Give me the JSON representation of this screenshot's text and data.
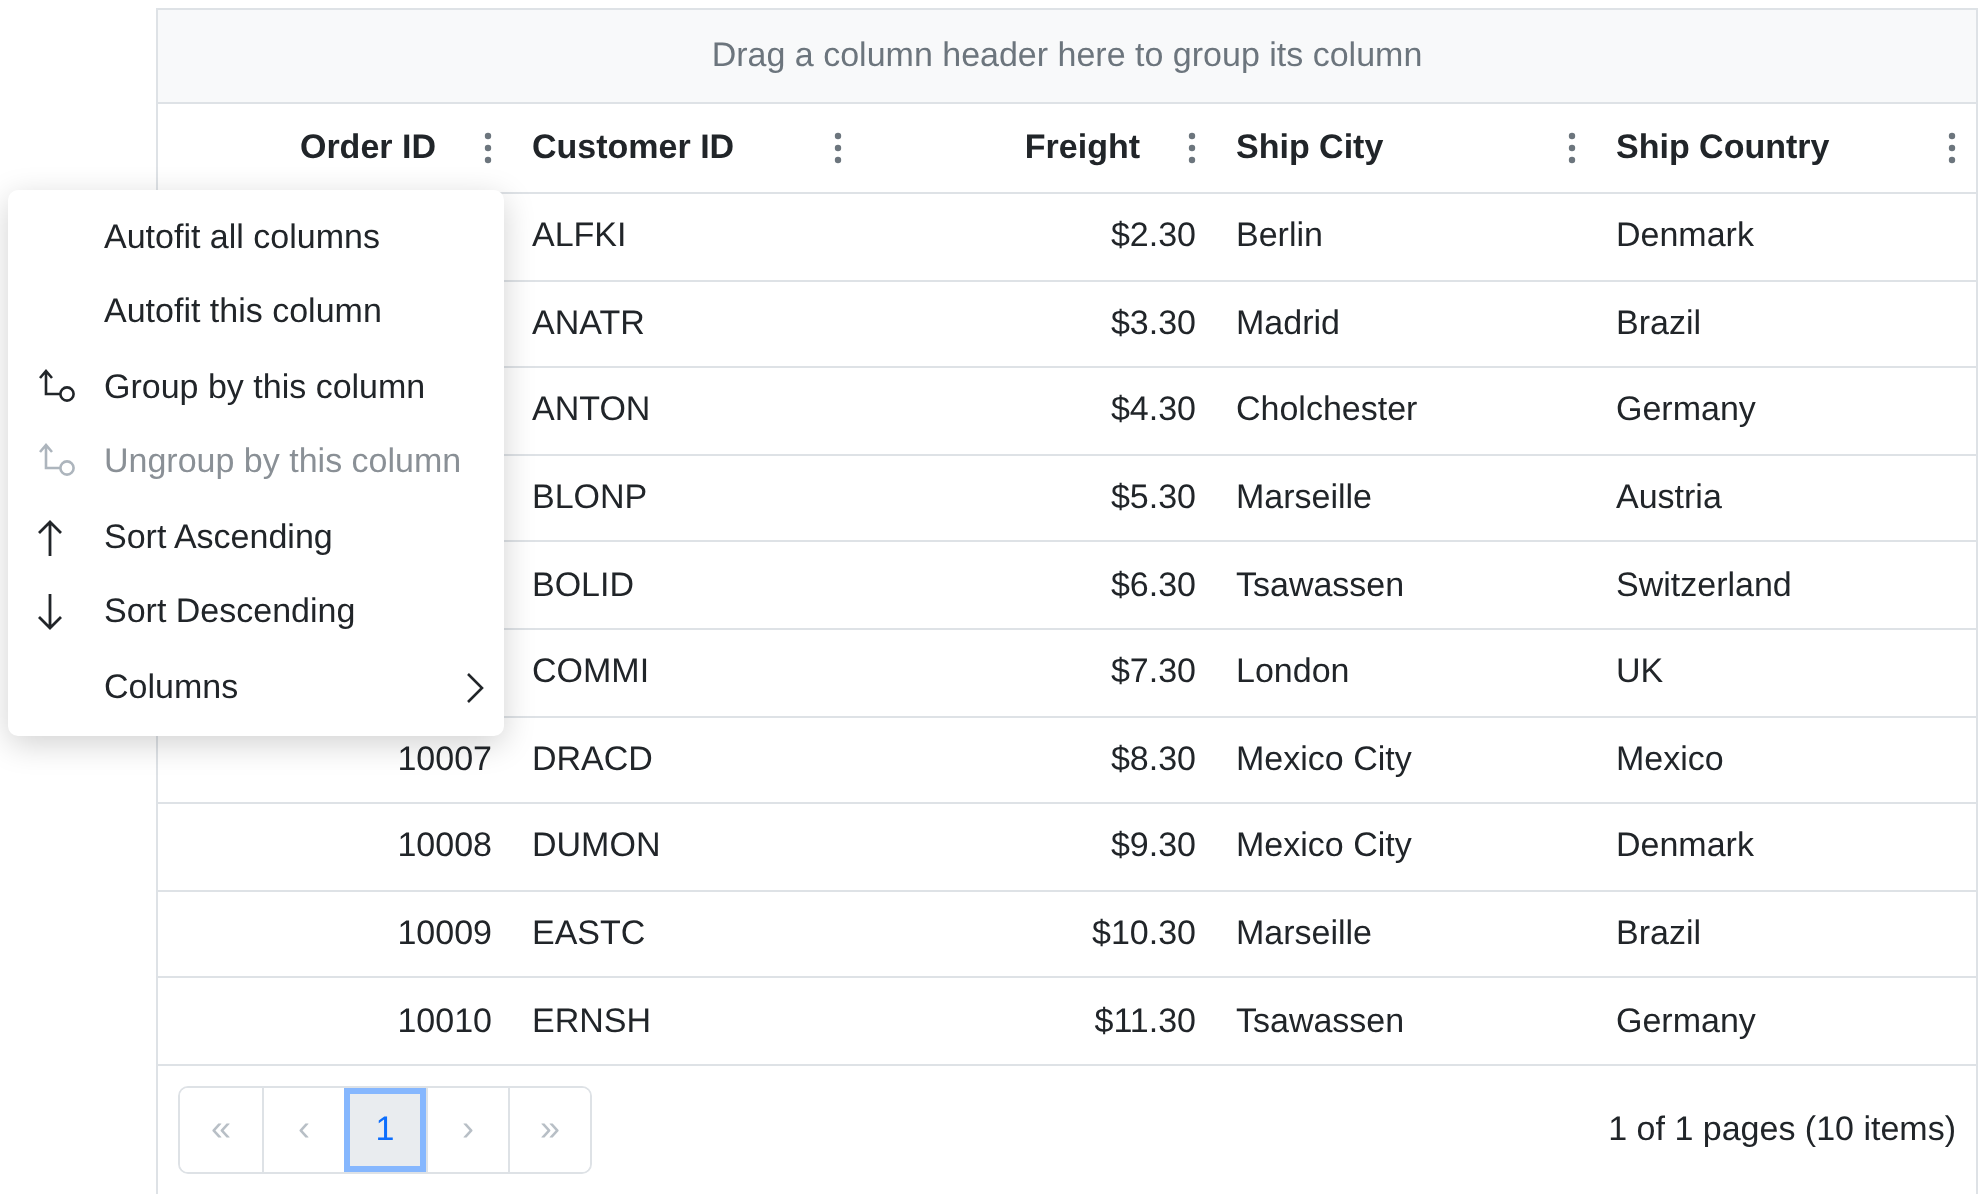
{
  "group_panel": {
    "placeholder": "Drag a column header here to group its column"
  },
  "columns": [
    {
      "label": "Order ID"
    },
    {
      "label": "Customer ID"
    },
    {
      "label": "Freight"
    },
    {
      "label": "Ship City"
    },
    {
      "label": "Ship Country"
    }
  ],
  "rows": [
    {
      "cells": [
        "",
        "ALFKI",
        "$2.30",
        "Berlin",
        "Denmark"
      ]
    },
    {
      "cells": [
        "",
        "ANATR",
        "$3.30",
        "Madrid",
        "Brazil"
      ]
    },
    {
      "cells": [
        "",
        "ANTON",
        "$4.30",
        "Cholchester",
        "Germany"
      ]
    },
    {
      "cells": [
        "",
        "BLONP",
        "$5.30",
        "Marseille",
        "Austria"
      ]
    },
    {
      "cells": [
        "",
        "BOLID",
        "$6.30",
        "Tsawassen",
        "Switzerland"
      ]
    },
    {
      "cells": [
        "",
        "COMMI",
        "$7.30",
        "London",
        "UK"
      ]
    },
    {
      "cells": [
        "10007",
        "DRACD",
        "$8.30",
        "Mexico City",
        "Mexico"
      ]
    },
    {
      "cells": [
        "10008",
        "DUMON",
        "$9.30",
        "Mexico City",
        "Denmark"
      ]
    },
    {
      "cells": [
        "10009",
        "EASTC",
        "$10.30",
        "Marseille",
        "Brazil"
      ]
    },
    {
      "cells": [
        "10010",
        "ERNSH",
        "$11.30",
        "Tsawassen",
        "Germany"
      ]
    }
  ],
  "pager": {
    "buttons": [
      {
        "label": "«",
        "kind": "nav",
        "disabled": true,
        "selected": false
      },
      {
        "label": "‹",
        "kind": "nav",
        "disabled": true,
        "selected": false
      },
      {
        "label": "1",
        "kind": "page",
        "disabled": false,
        "selected": true
      },
      {
        "label": "›",
        "kind": "nav",
        "disabled": true,
        "selected": false
      },
      {
        "label": "»",
        "kind": "nav",
        "disabled": true,
        "selected": false
      }
    ],
    "info": "1 of 1 pages (10 items)"
  },
  "context_menu": {
    "items": [
      {
        "label": "Autofit all columns",
        "kind": "plain",
        "disabled": false,
        "submenu": false
      },
      {
        "label": "Autofit this column",
        "kind": "plain",
        "disabled": false,
        "submenu": false
      },
      {
        "label": "Group by this column",
        "kind": "group",
        "disabled": false,
        "submenu": false
      },
      {
        "label": "Ungroup by this column",
        "kind": "group",
        "disabled": true,
        "submenu": false
      },
      {
        "label": "Sort Ascending",
        "kind": "up",
        "disabled": false,
        "submenu": false
      },
      {
        "label": "Sort Descending",
        "kind": "down",
        "disabled": false,
        "submenu": false
      },
      {
        "label": "Columns",
        "kind": "plain",
        "disabled": false,
        "submenu": true
      }
    ]
  }
}
